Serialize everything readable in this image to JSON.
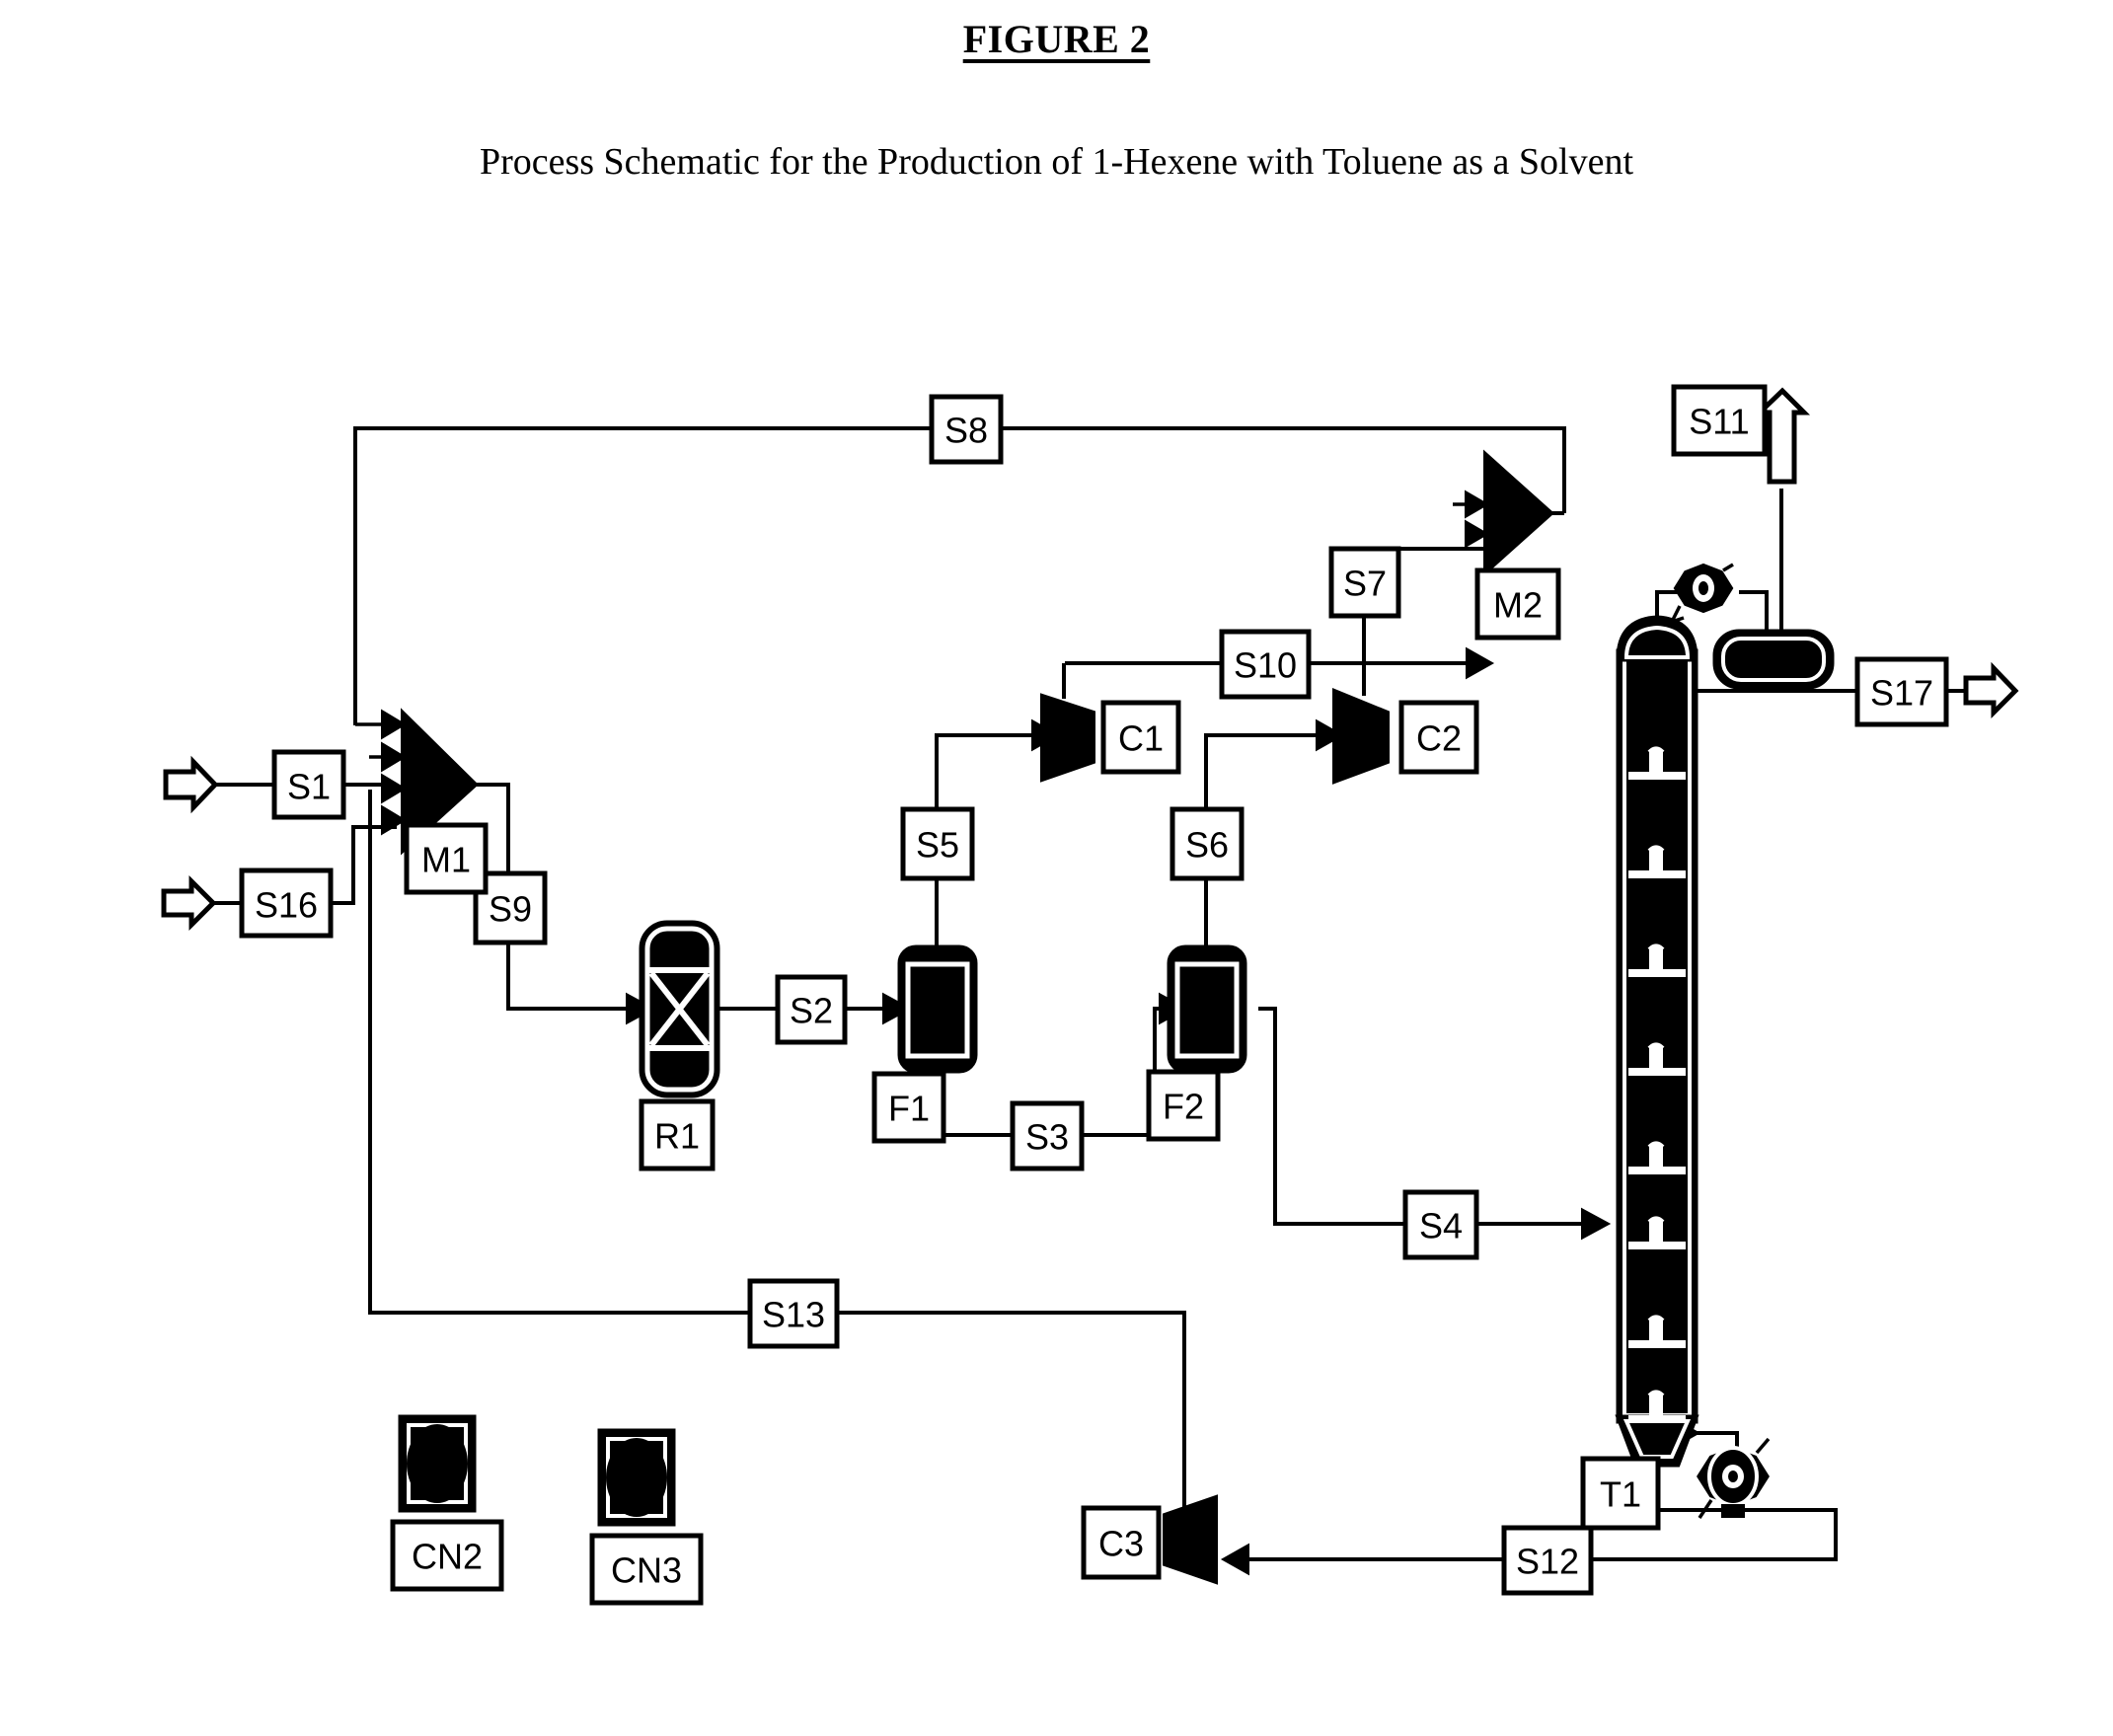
{
  "figure": {
    "title": "FIGURE 2",
    "subtitle": "Process Schematic for the Production of 1-Hexene with Toluene as a Solvent"
  },
  "streams": [
    {
      "id": "S1",
      "label": "S1"
    },
    {
      "id": "S2",
      "label": "S2"
    },
    {
      "id": "S3",
      "label": "S3"
    },
    {
      "id": "S4",
      "label": "S4"
    },
    {
      "id": "S5",
      "label": "S5"
    },
    {
      "id": "S6",
      "label": "S6"
    },
    {
      "id": "S7",
      "label": "S7"
    },
    {
      "id": "S8",
      "label": "S8"
    },
    {
      "id": "S9",
      "label": "S9"
    },
    {
      "id": "S10",
      "label": "S10"
    },
    {
      "id": "S11",
      "label": "S11"
    },
    {
      "id": "S12",
      "label": "S12"
    },
    {
      "id": "S13",
      "label": "S13"
    },
    {
      "id": "S16",
      "label": "S16"
    },
    {
      "id": "S17",
      "label": "S17"
    }
  ],
  "units": [
    {
      "id": "M1",
      "label": "M1",
      "type": "mixer"
    },
    {
      "id": "M2",
      "label": "M2",
      "type": "mixer"
    },
    {
      "id": "R1",
      "label": "R1",
      "type": "reactor"
    },
    {
      "id": "F1",
      "label": "F1",
      "type": "flash-drum"
    },
    {
      "id": "F2",
      "label": "F2",
      "type": "flash-drum"
    },
    {
      "id": "C1",
      "label": "C1",
      "type": "compressor"
    },
    {
      "id": "C2",
      "label": "C2",
      "type": "compressor"
    },
    {
      "id": "C3",
      "label": "C3",
      "type": "compressor"
    },
    {
      "id": "T1",
      "label": "T1",
      "type": "distillation-column"
    },
    {
      "id": "CN2",
      "label": "CN2",
      "type": "heat-exchanger"
    },
    {
      "id": "CN3",
      "label": "CN3",
      "type": "heat-exchanger"
    }
  ],
  "colors": {
    "line": "#000000",
    "fill": "#000000",
    "background": "#ffffff"
  }
}
